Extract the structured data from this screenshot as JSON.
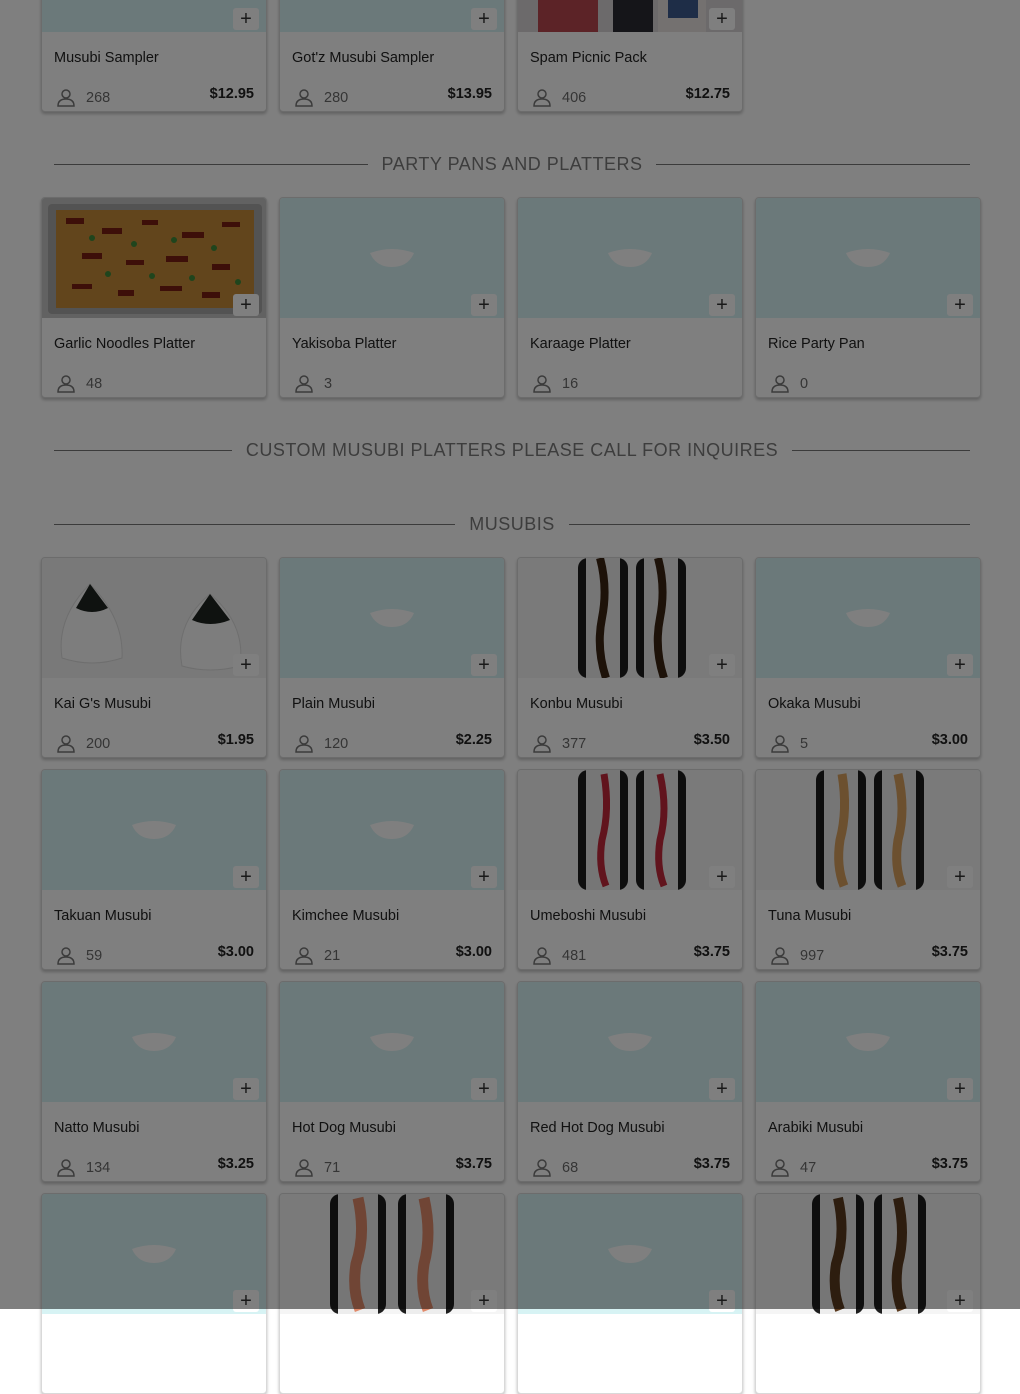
{
  "sections": [
    {
      "id": "party",
      "title": "PARTY PANS AND PLATTERS"
    },
    {
      "id": "custom",
      "title": "CUSTOM MUSUBI PLATTERS PLEASE CALL FOR INQUIRES"
    },
    {
      "id": "musubis",
      "title": "MUSUBIS"
    }
  ],
  "samplers": [
    {
      "name": "Musubi Sampler",
      "count": "268",
      "price": "$12.95"
    },
    {
      "name": "Got'z Musubi Sampler",
      "count": "280",
      "price": "$13.95"
    },
    {
      "name": "Spam Picnic Pack",
      "count": "406",
      "price": "$12.75"
    }
  ],
  "platters": [
    {
      "name": "Garlic Noodles Platter",
      "count": "48",
      "price": ""
    },
    {
      "name": "Yakisoba Platter",
      "count": "3",
      "price": ""
    },
    {
      "name": "Karaage Platter",
      "count": "16",
      "price": ""
    },
    {
      "name": "Rice Party Pan",
      "count": "0",
      "price": ""
    }
  ],
  "musubis": [
    {
      "name": "Kai G's Musubi",
      "count": "200",
      "price": "$1.95"
    },
    {
      "name": "Plain Musubi",
      "count": "120",
      "price": "$2.25"
    },
    {
      "name": "Konbu Musubi",
      "count": "377",
      "price": "$3.50"
    },
    {
      "name": "Okaka Musubi",
      "count": "5",
      "price": "$3.00"
    },
    {
      "name": "Takuan Musubi",
      "count": "59",
      "price": "$3.00"
    },
    {
      "name": "Kimchee Musubi",
      "count": "21",
      "price": "$3.00"
    },
    {
      "name": "Umeboshi Musubi",
      "count": "481",
      "price": "$3.75"
    },
    {
      "name": "Tuna Musubi",
      "count": "997",
      "price": "$3.75"
    },
    {
      "name": "Natto Musubi",
      "count": "134",
      "price": "$3.25"
    },
    {
      "name": "Hot Dog Musubi",
      "count": "71",
      "price": "$3.75"
    },
    {
      "name": "Red Hot Dog Musubi",
      "count": "68",
      "price": "$3.75"
    },
    {
      "name": "Arabiki Musubi",
      "count": "47",
      "price": "$3.75"
    }
  ],
  "add_symbol": "+",
  "icons": {
    "add": "plus-icon",
    "count": "person-icon",
    "placeholder": "bowl-icon"
  },
  "colors": {
    "placeholder_bg": "#d7f3f4",
    "overlay": "rgba(0,0,0,0.5)",
    "section_label": "#7a7a7a"
  }
}
